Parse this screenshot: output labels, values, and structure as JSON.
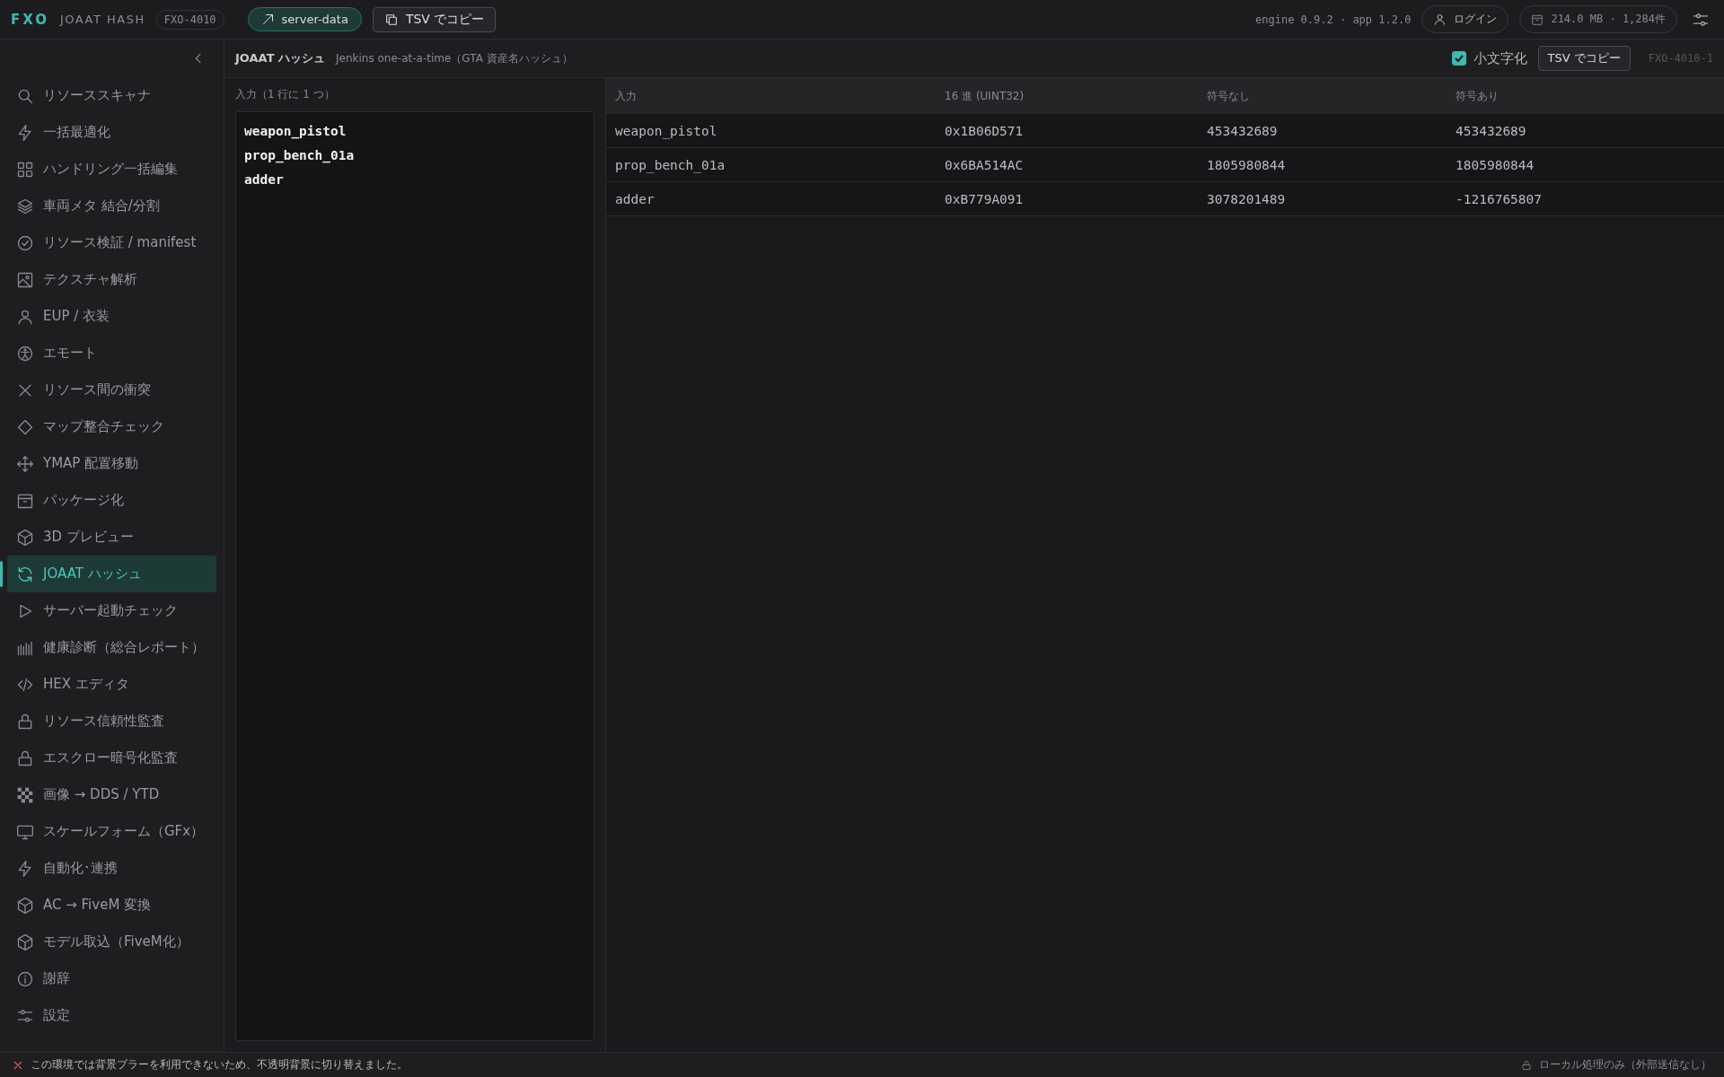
{
  "topbar": {
    "logo": "FXO",
    "app_name": "JOAAT HASH",
    "code": "FXO-4010",
    "server_button": "server-data",
    "copy_button": "TSV でコピー",
    "version": "engine 0.9.2 · app 1.2.0",
    "login_button": "ログイン",
    "storage": "214.0 MB · 1,284件"
  },
  "sidebar": {
    "items": [
      {
        "label": "リソーススキャナ",
        "selected": false
      },
      {
        "label": "一括最適化",
        "selected": false
      },
      {
        "label": "ハンドリング一括編集",
        "selected": false
      },
      {
        "label": "車両メタ 結合/分割",
        "selected": false
      },
      {
        "label": "リソース検証 / manifest",
        "selected": false
      },
      {
        "label": "テクスチャ解析",
        "selected": false
      },
      {
        "label": "EUP / 衣装",
        "selected": false
      },
      {
        "label": "エモート",
        "selected": false
      },
      {
        "label": "リソース間の衝突",
        "selected": false
      },
      {
        "label": "マップ整合チェック",
        "selected": false
      },
      {
        "label": "YMAP 配置移動",
        "selected": false
      },
      {
        "label": "パッケージ化",
        "selected": false
      },
      {
        "label": "3D プレビュー",
        "selected": false
      },
      {
        "label": "JOAAT ハッシュ",
        "selected": true
      },
      {
        "label": "サーバー起動チェック",
        "selected": false
      },
      {
        "label": "健康診断（総合レポート）",
        "selected": false
      },
      {
        "label": "HEX エディタ",
        "selected": false
      },
      {
        "label": "リソース信頼性監査",
        "selected": false
      },
      {
        "label": "エスクロー暗号化監査",
        "selected": false
      },
      {
        "label": "画像 → DDS / YTD",
        "selected": false
      },
      {
        "label": "スケールフォーム（GFx）",
        "selected": false
      },
      {
        "label": "自動化･連携",
        "selected": false
      },
      {
        "label": "AC → FiveM 変換",
        "selected": false
      },
      {
        "label": "モデル取込（FiveM化）",
        "selected": false
      },
      {
        "label": "謝辞",
        "selected": false
      },
      {
        "label": "設定",
        "selected": false
      }
    ]
  },
  "panel": {
    "title": "JOAAT ハッシュ",
    "subtitle": "Jenkins one-at-a-time（GTA 資産名ハッシュ）",
    "lowercase": {
      "label": "小文字化",
      "checked": true
    },
    "copy_button": "TSV でコピー",
    "panel_id": "FXO-4010-1"
  },
  "input": {
    "label": "入力（1 行に 1 つ）",
    "lines": [
      "weapon_pistol",
      "prop_bench_01a",
      "adder"
    ]
  },
  "table": {
    "columns": [
      "入力",
      "16 進 (UINT32)",
      "符号なし",
      "符号あり"
    ],
    "rows": [
      [
        "weapon_pistol",
        "0x1B06D571",
        "453432689",
        "453432689"
      ],
      [
        "prop_bench_01a",
        "0x6BA514AC",
        "1805980844",
        "1805980844"
      ],
      [
        "adder",
        "0xB779A091",
        "3078201489",
        "-1216765807"
      ]
    ]
  },
  "status_bar": {
    "message": "この環境では背景ブラーを利用できないため、不透明背景に切り替えました。",
    "privacy": "ローカル処理のみ（外部送信なし）"
  }
}
